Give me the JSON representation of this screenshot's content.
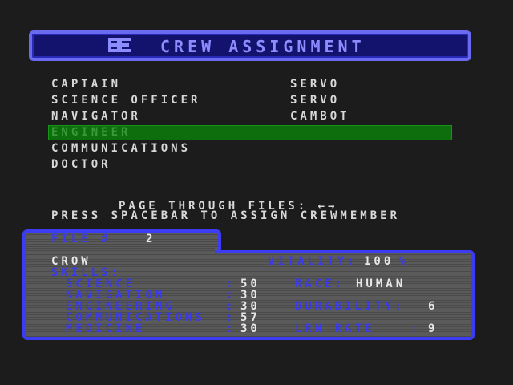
{
  "header": {
    "logo_icon": "starship-logo-icon",
    "title": "CREW ASSIGNMENT"
  },
  "roster": [
    {
      "role": "CAPTAIN",
      "assignee": "SERVO"
    },
    {
      "role": "SCIENCE OFFICER",
      "assignee": "SERVO"
    },
    {
      "role": "NAVIGATOR",
      "assignee": "CAMBOT"
    },
    {
      "role": "ENGINEER",
      "assignee": ""
    },
    {
      "role": "COMMUNICATIONS",
      "assignee": ""
    },
    {
      "role": "DOCTOR",
      "assignee": ""
    }
  ],
  "selected_role_index": 3,
  "instructions": {
    "page_files": "PAGE THROUGH FILES:",
    "page_arrows": "←→",
    "assign": "PRESS SPACEBAR TO ASSIGN CREWMEMBER"
  },
  "file": {
    "label": "FILE #",
    "number": "2",
    "name": "CROW",
    "vitality_label": "VITALITY:",
    "vitality_value": "100",
    "vitality_unit": "%",
    "skills_label": "SKILLS:",
    "skills": [
      {
        "name": "SCIENCE",
        "value": "50"
      },
      {
        "name": "NAVIGATION",
        "value": "30"
      },
      {
        "name": "ENGINEERING",
        "value": "30"
      },
      {
        "name": "COMMUNICATIONS",
        "value": "57"
      },
      {
        "name": "MEDICINE",
        "value": "30"
      }
    ],
    "race_label": "RACE:",
    "race_value": "HUMAN",
    "durability_label": "DURABILITY:",
    "durability_value": "6",
    "lrn_rate_label": "LRN RATE",
    "lrn_rate_value": "9"
  },
  "colors": {
    "background": "#1c1c1c",
    "title_border": "#6a6af0",
    "title_text": "#8c8cff",
    "highlight": "#0e6e0e",
    "panel_border": "#3c3cf4",
    "panel_bg": "#5a5a5a",
    "label_blue": "#3a3ae8",
    "text_white": "#d8d8d8"
  }
}
